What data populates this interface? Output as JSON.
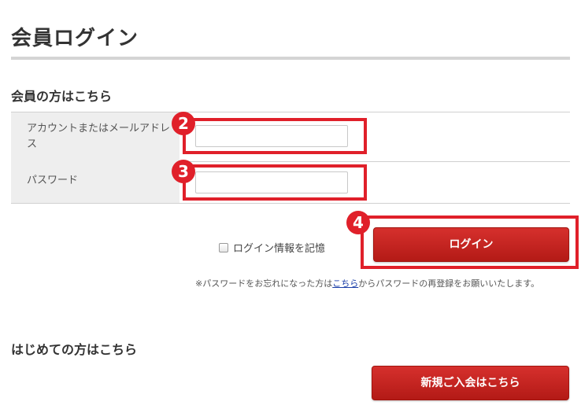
{
  "page": {
    "title": "会員ログイン"
  },
  "member_section": {
    "heading": "会員の方はこちら",
    "fields": [
      {
        "label": "アカウントまたはメールアドレス",
        "value": "",
        "placeholder": ""
      },
      {
        "label": "パスワード",
        "value": "",
        "placeholder": ""
      }
    ],
    "remember_label": "ログイン情報を記憶",
    "remember_checked": false,
    "login_button": "ログイン",
    "note": {
      "before": "※パスワードをお忘れになった方は",
      "link": "こちら",
      "after": "からパスワードの再登録をお願いいたします。"
    }
  },
  "annotations": {
    "badges": [
      "2",
      "3",
      "4"
    ],
    "highlight_color": "#e0202a"
  },
  "new_member_section": {
    "heading": "はじめての方はこちら",
    "register_button": "新規ご入会はこちら"
  },
  "colors": {
    "button_red": "#c3211d",
    "label_bg": "#eeeeee",
    "rule_gray": "#d4d4d4",
    "link_blue": "#1a3ea8"
  }
}
